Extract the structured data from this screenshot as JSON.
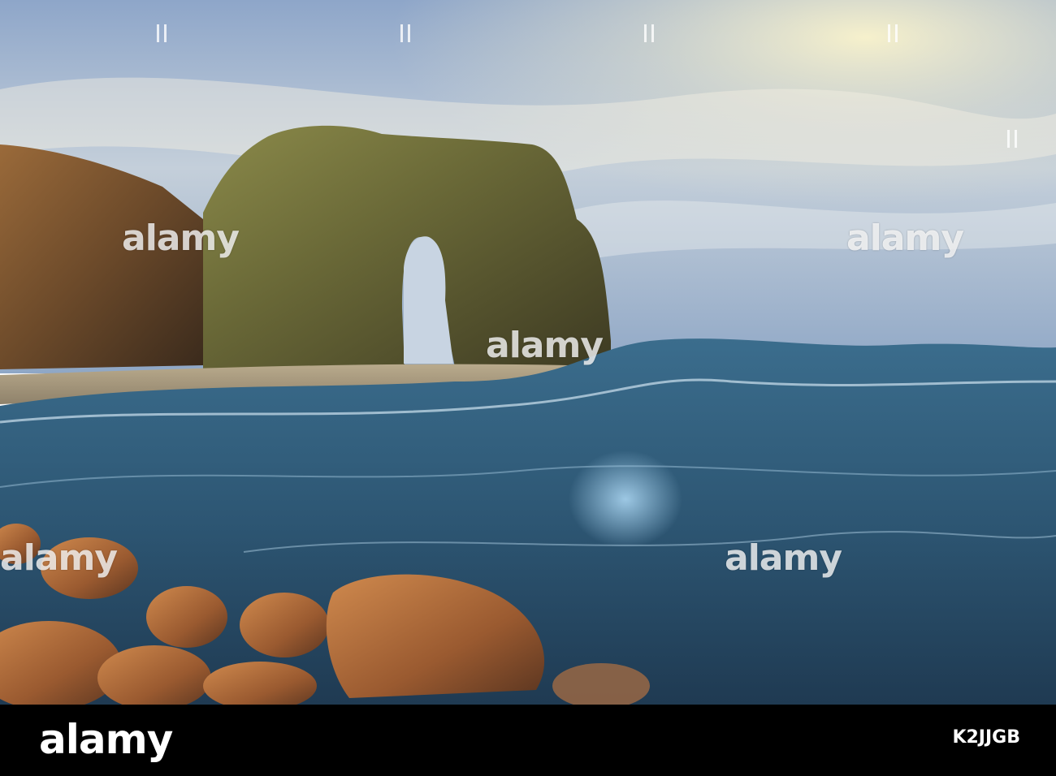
{
  "photo": {
    "subject": "sea-arch-with-waves-and-pebbles"
  },
  "watermark": {
    "brand": "alamy"
  },
  "footer": {
    "logo": "alamy",
    "image_id": "K2JJGB",
    "background": "#000000"
  },
  "colors": {
    "sky_top": "#8fa7c8",
    "sky_bright": "#f6f1cf",
    "rock": "#6a6a38",
    "wave": "#3f6f8f",
    "pebble": "#b0683c"
  }
}
